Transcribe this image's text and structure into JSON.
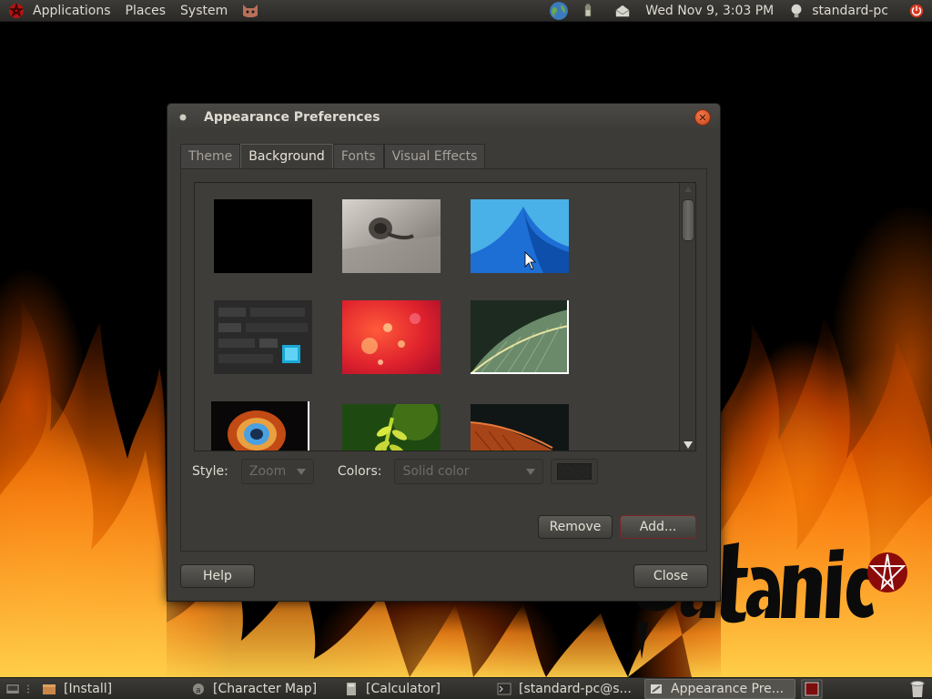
{
  "top_panel": {
    "menus": [
      "Applications",
      "Places",
      "System"
    ],
    "clock": "Wed Nov 9,  3:03 PM",
    "username": "standard-pc"
  },
  "dialog": {
    "title": "Appearance Preferences",
    "tabs": [
      {
        "label": "Theme",
        "active": false
      },
      {
        "label": "Background",
        "active": true
      },
      {
        "label": "Fonts",
        "active": false
      },
      {
        "label": "Visual Effects",
        "active": false
      }
    ],
    "style_label": "Style:",
    "style_value": "Zoom",
    "colors_label": "Colors:",
    "colors_value": "Solid color",
    "remove_label": "Remove",
    "add_label": "Add...",
    "help_label": "Help",
    "close_label": "Close"
  },
  "taskbar": {
    "tasks": [
      {
        "label": "[Install]",
        "active": false
      },
      {
        "label": "[Character Map]",
        "active": false
      },
      {
        "label": "[Calculator]",
        "active": false
      },
      {
        "label": "[standard-pc@s...",
        "active": false
      },
      {
        "label": "Appearance Pre...",
        "active": true
      }
    ]
  },
  "colors": {
    "panel_bg": "#3c3b37",
    "selection": "#7d0c0c",
    "close_button": "#e0562a",
    "fire": "#ff8c1a"
  },
  "icons": [
    "app-menu-logo-icon",
    "cat-icon",
    "globe-icon",
    "battery-icon",
    "mail-icon",
    "bulb-icon",
    "power-icon",
    "close-icon",
    "trash-icon"
  ]
}
